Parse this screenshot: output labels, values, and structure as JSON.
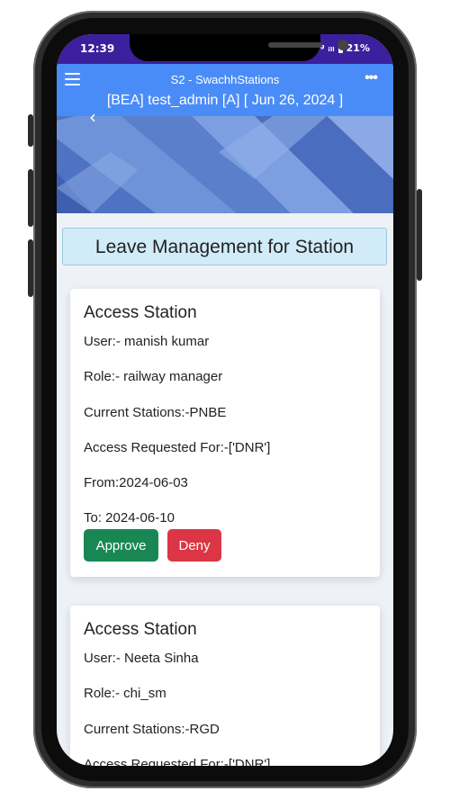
{
  "status_bar": {
    "time": "12:39",
    "signal": "ᵍ ᵢₗₗ",
    "battery": "21%"
  },
  "header": {
    "app_title": "S2 - SwachhStations",
    "user_info": "[BEA] test_admin [A] [ Jun 26, 2024 ]",
    "menu_icon": "hamburger-icon",
    "more_icon": "more-dots-icon",
    "back_icon": "chevron-left-icon",
    "more_glyph": "•••",
    "back_glyph": "‹"
  },
  "page": {
    "title": "Leave Management for Station"
  },
  "requests": [
    {
      "title": "Access Station",
      "user": "User:- manish kumar",
      "role": "Role:- railway manager",
      "current": "Current Stations:-PNBE",
      "requested": "Access Requested For:-['DNR']",
      "from": "From:2024-06-03",
      "to": "To: 2024-06-10",
      "approve_label": "Approve",
      "deny_label": "Deny"
    },
    {
      "title": "Access Station",
      "user": "User:- Neeta Sinha",
      "role": "Role:- chi_sm",
      "current": "Current Stations:-RGD",
      "requested": "Access Requested For:-['DNR']"
    }
  ],
  "colors": {
    "status_bar": "#3c1f9c",
    "app_bar": "#4a8cf7",
    "approve": "#198754",
    "deny": "#dc3545",
    "title_box": "#d1ecf8"
  }
}
